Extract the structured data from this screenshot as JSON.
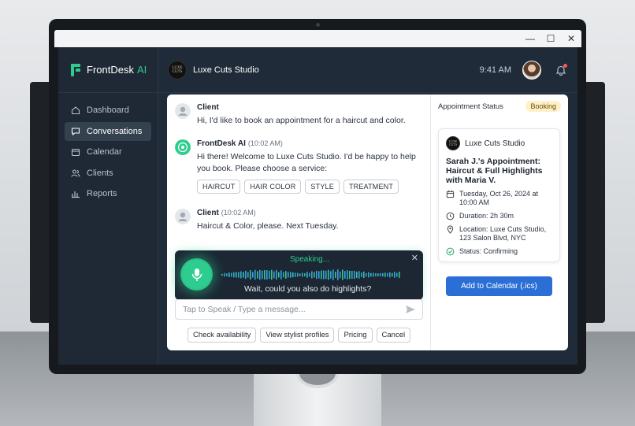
{
  "window": {
    "minimize": "—",
    "maximize": "☐",
    "close": "✕"
  },
  "brand": {
    "name": "FrontDesk",
    "suffix": "AI"
  },
  "sidebar": {
    "items": [
      {
        "label": "Dashboard",
        "icon": "home-icon",
        "active": false
      },
      {
        "label": "Conversations",
        "icon": "chat-icon",
        "active": true
      },
      {
        "label": "Calendar",
        "icon": "calendar-icon",
        "active": false
      },
      {
        "label": "Clients",
        "icon": "users-icon",
        "active": false
      },
      {
        "label": "Reports",
        "icon": "bar-chart-icon",
        "active": false
      }
    ]
  },
  "header": {
    "studio_logo_line1": "LUXE",
    "studio_logo_line2": "CUTS",
    "studio_name": "Luxe Cuts Studio",
    "time": "9:41 AM"
  },
  "chat": {
    "messages": [
      {
        "sender": "Client",
        "time": "",
        "text": "Hi, I'd like to book an appointment for a haircut and color."
      },
      {
        "sender": "FrontDesk AI",
        "time": "(10:02 AM)",
        "text": "Hi there! Welcome to Luxe Cuts Studio. I'd be happy to help you book. Please choose a service:"
      },
      {
        "sender": "Client",
        "time": "(10:02 AM)",
        "text": "Haircut & Color, please. Next Tuesday."
      }
    ],
    "service_chips": [
      "HAIRCUT",
      "HAIR COLOR",
      "STYLE",
      "TREATMENT"
    ],
    "voice": {
      "status": "Speaking...",
      "transcript": "Wait, could you also do highlights?",
      "close": "✕"
    },
    "input_placeholder": "Tap to Speak / Type a message...",
    "quick_replies": [
      "Check availability",
      "View stylist profiles",
      "Pricing",
      "Cancel"
    ]
  },
  "appointment": {
    "panel_title": "Appointment Status",
    "badge": "Booking",
    "studio_name": "Luxe Cuts Studio",
    "title": "Sarah J.'s Appointment: Haircut & Full Highlights with Maria V.",
    "date": "Tuesday, Oct 26, 2024 at 10:00 AM",
    "duration": "Duration: 2h 30m",
    "location": "Location: Luxe Cuts Studio, 123 Salon Blvd, NYC",
    "status": "Status: Confirming",
    "add_button": "Add to Calendar (.ics)"
  },
  "colors": {
    "accent": "#2ecc8f",
    "primary_button": "#2b6fd6",
    "sidebar_bg": "#1e2935",
    "badge_bg": "#fff0c8"
  }
}
